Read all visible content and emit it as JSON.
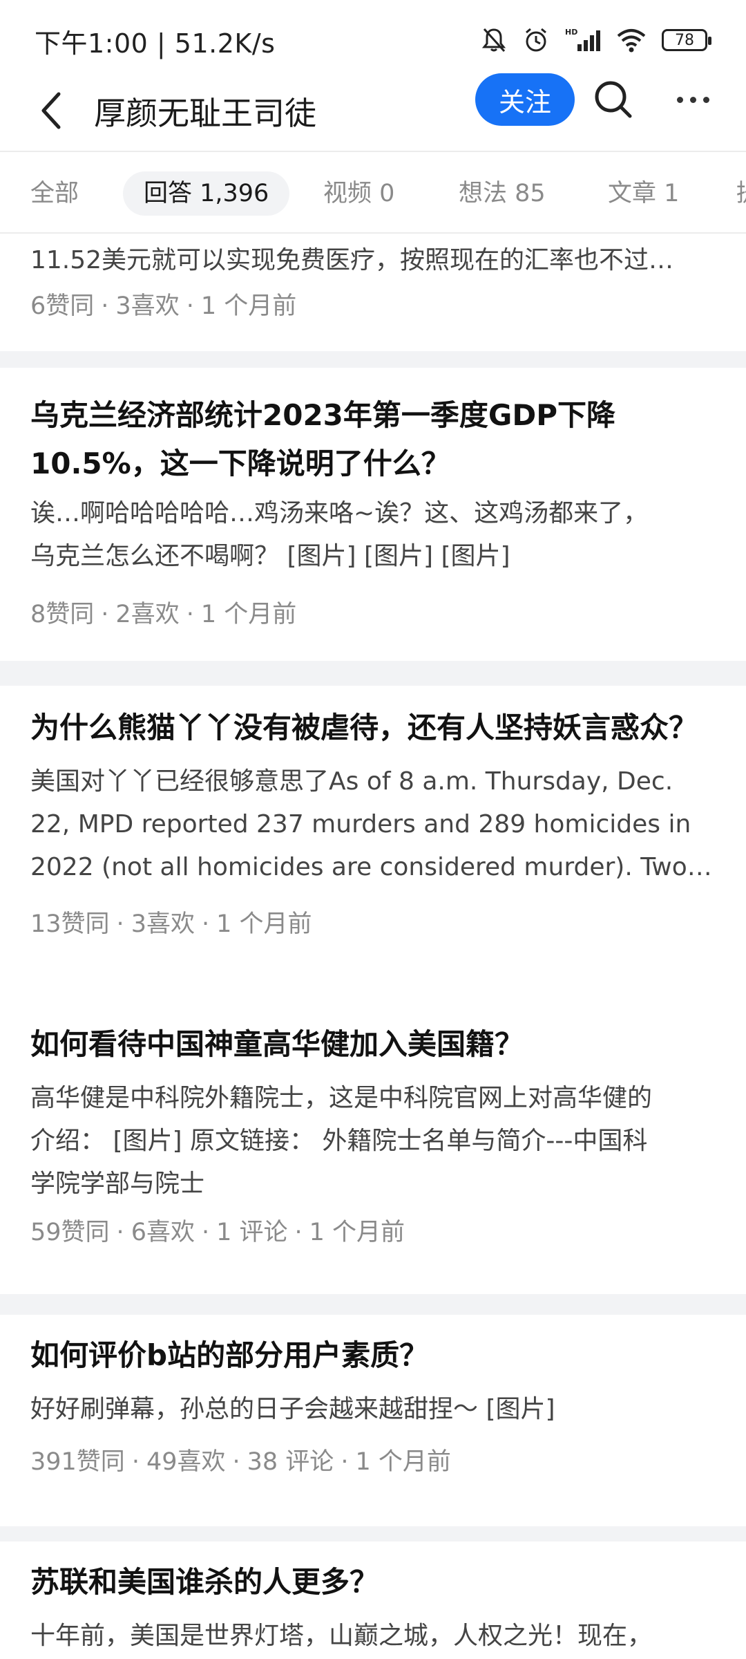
{
  "status_bar": {
    "time_speed": "下午1:00 | 51.2K/s",
    "battery": "78",
    "icons": [
      "mute-bell-icon",
      "alarm-icon",
      "hd-signal-icon",
      "wifi-icon",
      "battery-icon"
    ]
  },
  "header": {
    "title": "厚颜无耻王司徒",
    "follow_label": "关注",
    "accent_color": "#1772f6",
    "icons": [
      "back-arrow-icon",
      "search-icon",
      "more-icon"
    ]
  },
  "tabs": [
    {
      "label": "全部"
    },
    {
      "label": "回答 1,396"
    },
    {
      "label": "视频 0"
    },
    {
      "label": "想法 85"
    },
    {
      "label": "文章 1"
    },
    {
      "label": "提"
    }
  ],
  "active_tab": "回答 1,396",
  "feed": [
    {
      "title": "",
      "excerpt": [
        "11.52美元就可以实现免费医疗，按照现在的汇率也不过…"
      ],
      "meta": [
        "6赞同",
        "3喜欢",
        "1 个月前"
      ]
    },
    {
      "title": [
        "乌克兰经济部统计2023年第一季度GDP下降",
        "10.5%，这一下降说明了什么？"
      ],
      "excerpt": [
        "诶…啊哈哈哈哈哈…鸡汤来咯~诶？这、这鸡汤都来了，",
        "乌克兰怎么还不喝啊？ [图片] [图片] [图片]"
      ],
      "meta": [
        "8赞同",
        "2喜欢",
        "1 个月前"
      ]
    },
    {
      "title": [
        "为什么熊猫丫丫没有被虐待，还有人坚持妖言惑众？"
      ],
      "excerpt": [
        "美国对丫丫已经很够意思了As of 8 a.m. Thursday, Dec.",
        "22, MPD reported 237 murders and 289 homicides in",
        "2022 (not all homicides are considered murder). Two…"
      ],
      "meta": [
        "13赞同",
        "3喜欢",
        "1 个月前"
      ]
    },
    {
      "title": [
        "如何看待中国神童高华健加入美国籍？"
      ],
      "excerpt": [
        "高华健是中科院外籍院士，这是中科院官网上对高华健的",
        "介绍： [图片] 原文链接： 外籍院士名单与简介---中国科",
        "学院学部与院士"
      ],
      "meta": [
        "59赞同",
        "6喜欢",
        "1 评论",
        "1 个月前"
      ]
    },
    {
      "title": [
        "如何评价b站的部分用户素质？"
      ],
      "excerpt": [
        "好好刷弹幕，孙总的日子会越来越甜捏～ [图片]"
      ],
      "meta": [
        "391赞同",
        "49喜欢",
        "38 评论",
        "1 个月前"
      ]
    },
    {
      "title": [
        "苏联和美国谁杀的人更多？"
      ],
      "excerpt": [
        "十年前，美国是世界灯塔，山巅之城，人权之光！现在，"
      ],
      "meta": []
    }
  ]
}
